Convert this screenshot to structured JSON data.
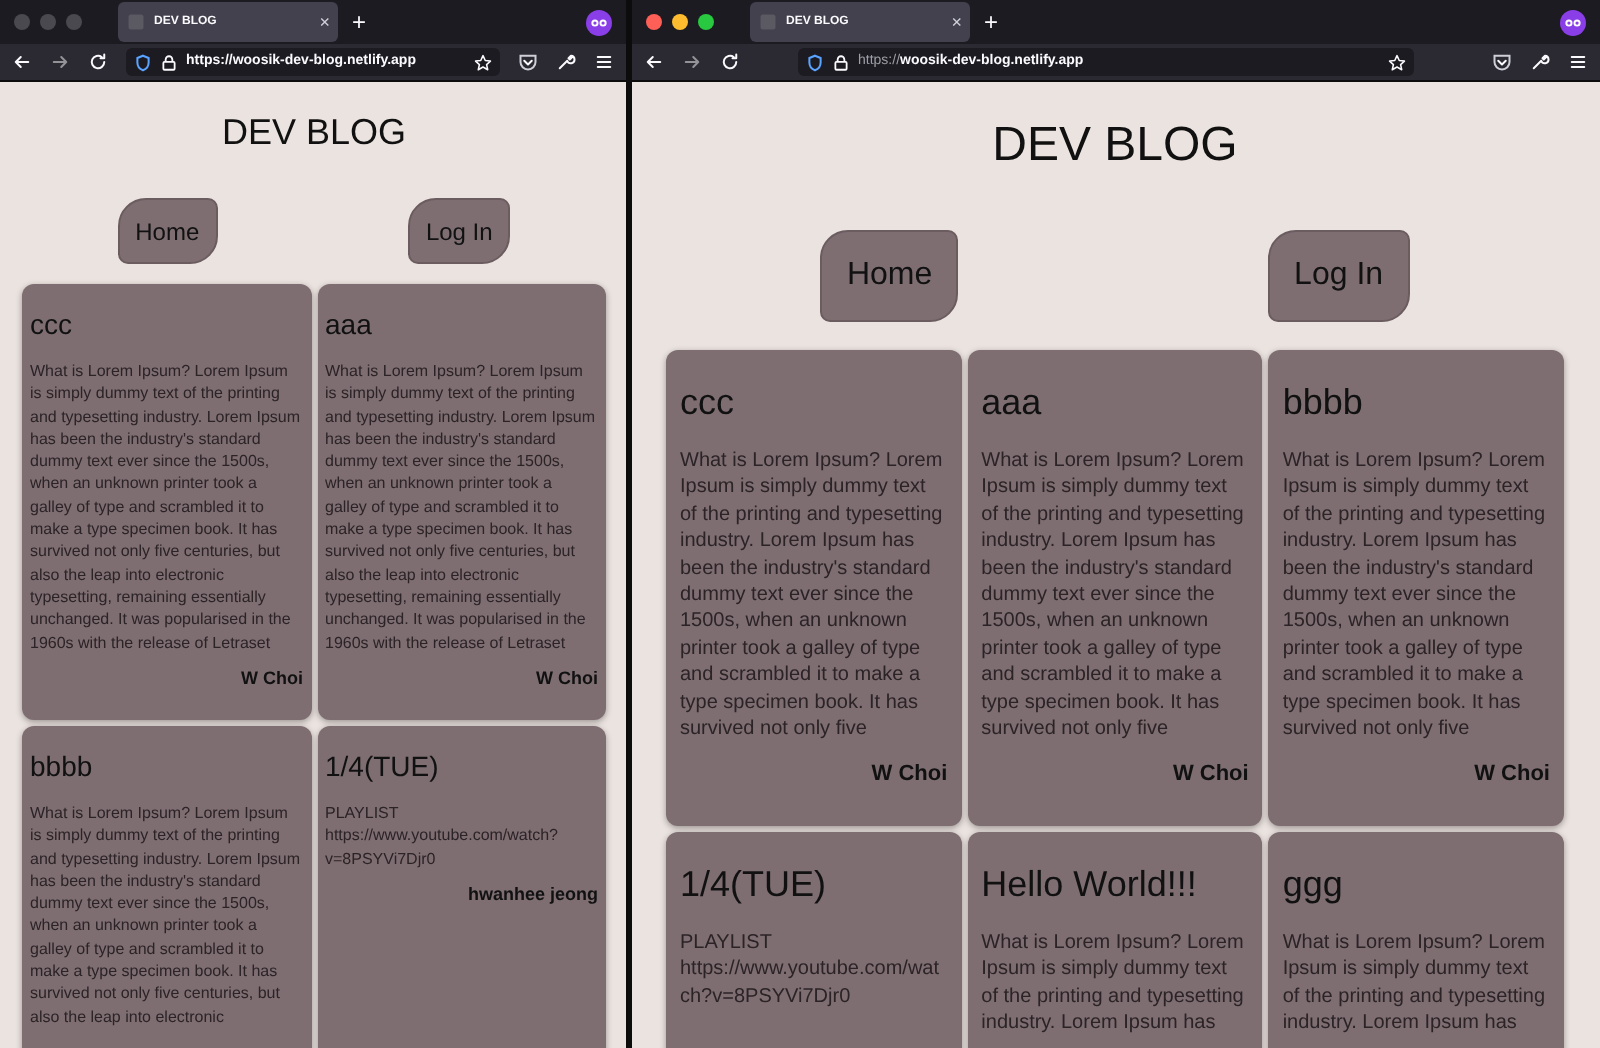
{
  "windows": [
    {
      "active": false,
      "tab": {
        "title": "DEV BLOG",
        "close": "×"
      },
      "new_tab": "+",
      "url": "https://woosik-dev-blog.netlify.app",
      "page": {
        "title": "DEV BLOG",
        "nav": [
          "Home",
          "Log In"
        ],
        "posts": [
          {
            "title": "ccc",
            "body": "What is Lorem Ipsum? Lorem Ipsum is simply dummy text of the printing and typesetting industry. Lorem Ipsum has been the industry's standard dummy text ever since the 1500s, when an unknown printer took a galley of type and scrambled it to make a type specimen book. It has survived not only five centuries, but also the leap into electronic typesetting, remaining essentially unchanged. It was popularised in the 1960s with the release of Letraset",
            "author": "W Choi"
          },
          {
            "title": "aaa",
            "body": "What is Lorem Ipsum? Lorem Ipsum is simply dummy text of the printing and typesetting industry. Lorem Ipsum has been the industry's standard dummy text ever since the 1500s, when an unknown printer took a galley of type and scrambled it to make a type specimen book. It has survived not only five centuries, but also the leap into electronic typesetting, remaining essentially unchanged. It was popularised in the 1960s with the release of Letraset",
            "author": "W Choi"
          },
          {
            "title": "bbbb",
            "body": "What is Lorem Ipsum? Lorem Ipsum is simply dummy text of the printing and typesetting industry. Lorem Ipsum has been the industry's standard dummy text ever since the 1500s, when an unknown printer took a galley of type and scrambled it to make a type specimen book. It has survived not only five centuries, but also the leap into electronic"
          },
          {
            "title": "1/4(TUE)",
            "body": "PLAYLIST https://www.youtube.com/watch?v=8PSYVi7Djr0",
            "author": "hwanhee jeong"
          }
        ]
      }
    },
    {
      "active": true,
      "tab": {
        "title": "DEV BLOG",
        "close": "×"
      },
      "new_tab": "+",
      "url": "https://**woosik-dev-blog.netlify.app**",
      "page": {
        "title": "DEV BLOG",
        "nav": [
          "Home",
          "Log In"
        ],
        "posts": [
          {
            "title": "ccc",
            "body": "What is Lorem Ipsum? Lorem Ipsum is simply dummy text of the printing and typesetting industry. Lorem Ipsum has been the industry's standard dummy text ever since the 1500s, when an unknown printer took a galley of type and scrambled it to make a type specimen book. It has survived not only five",
            "author": "W Choi"
          },
          {
            "title": "aaa",
            "body": "What is Lorem Ipsum? Lorem Ipsum is simply dummy text of the printing and typesetting industry. Lorem Ipsum has been the industry's standard dummy text ever since the 1500s, when an unknown printer took a galley of type and scrambled it to make a type specimen book. It has survived not only five",
            "author": "W Choi"
          },
          {
            "title": "bbbb",
            "body": "What is Lorem Ipsum? Lorem Ipsum is simply dummy text of the printing and typesetting industry. Lorem Ipsum has been the industry's standard dummy text ever since the 1500s, when an unknown printer took a galley of type and scrambled it to make a type specimen book. It has survived not only five",
            "author": "W Choi"
          },
          {
            "title": "1/4(TUE)",
            "body": "PLAYLIST https://www.youtube.com/watch?v=8PSYVi7Djr0"
          },
          {
            "title": "Hello World!!!",
            "body": "What is Lorem Ipsum? Lorem Ipsum is simply dummy text of the printing and typesetting industry. Lorem Ipsum has"
          },
          {
            "title": "ggg",
            "body": "What is Lorem Ipsum? Lorem Ipsum is simply dummy text of the printing and typesetting industry. Lorem Ipsum has"
          }
        ]
      }
    }
  ]
}
